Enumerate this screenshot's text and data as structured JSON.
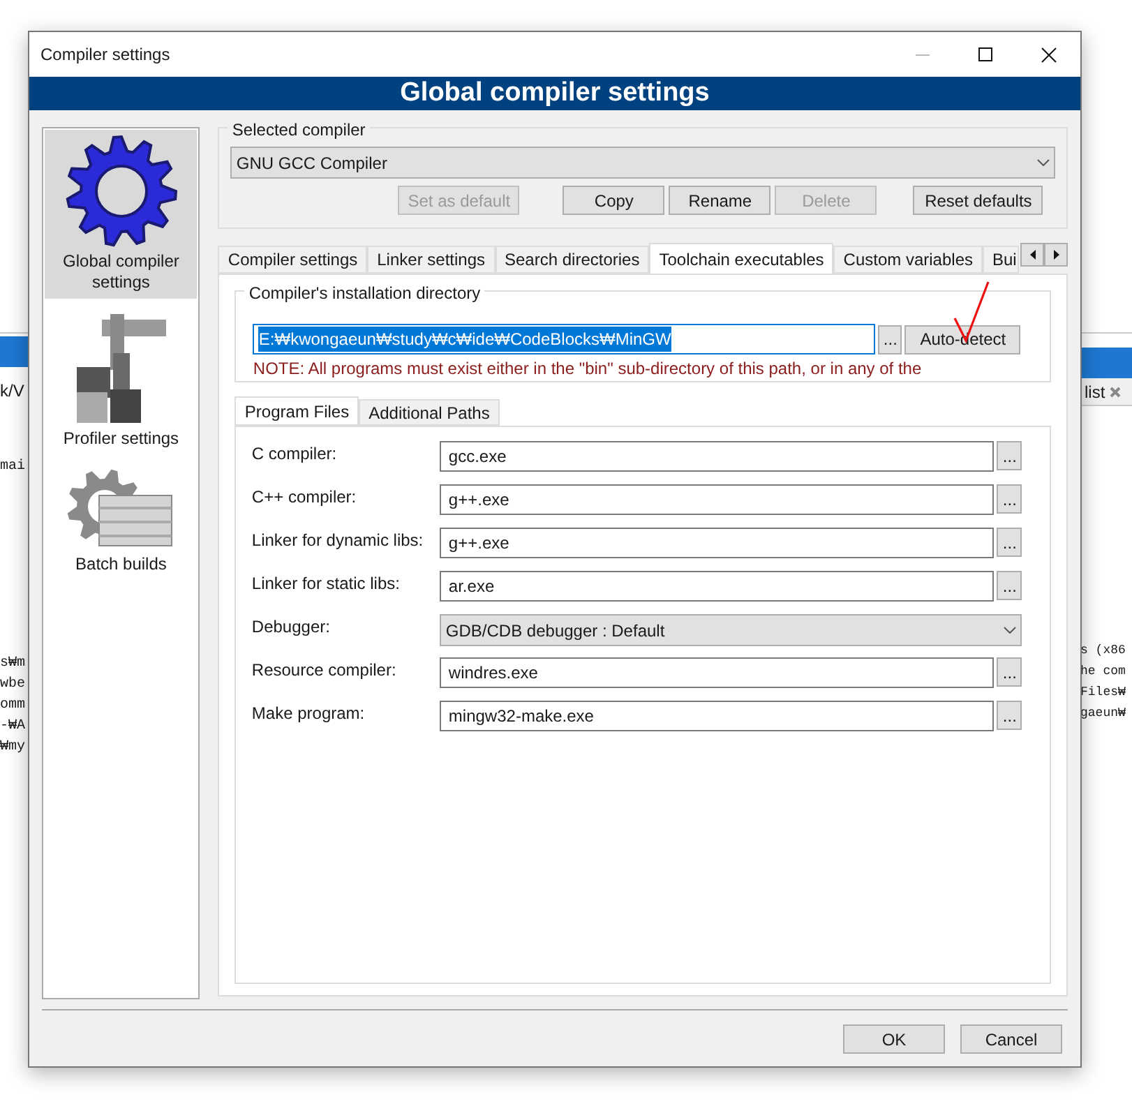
{
  "left_window": {
    "tab_text": "k/V",
    "code_blocks": [
      [
        "mai"
      ],
      [
        "s₩m",
        "wbe",
        "omm",
        "-₩A",
        "₩my"
      ]
    ]
  },
  "right_window": {
    "tab_text": "list",
    "code_lines": [
      "s (x86",
      "he com",
      "Files₩",
      "gaeun₩"
    ]
  },
  "window": {
    "title": "Compiler settings"
  },
  "header": "Global compiler settings",
  "sidebar": {
    "items": [
      {
        "label": "Global compiler settings",
        "selected": true,
        "kind": "gear"
      },
      {
        "label": "Profiler settings",
        "selected": false,
        "kind": "caliper"
      },
      {
        "label": "Batch builds",
        "selected": false,
        "kind": "batch"
      }
    ]
  },
  "selected_compiler": {
    "legend": "Selected compiler",
    "value": "GNU GCC Compiler",
    "buttons": [
      {
        "label": "Set as default",
        "disabled": true
      },
      {
        "label": "Copy",
        "disabled": false
      },
      {
        "label": "Rename",
        "disabled": false
      },
      {
        "label": "Delete",
        "disabled": true
      },
      {
        "label": "Reset defaults",
        "disabled": false
      }
    ]
  },
  "tabs": [
    {
      "label": "Compiler settings",
      "selected": false
    },
    {
      "label": "Linker settings",
      "selected": false
    },
    {
      "label": "Search directories",
      "selected": false
    },
    {
      "label": "Toolchain executables",
      "selected": true
    },
    {
      "label": "Custom variables",
      "selected": false
    },
    {
      "label": "Bui",
      "selected": false
    }
  ],
  "install_dir": {
    "legend": "Compiler's installation directory",
    "value": "E:₩kwongaeun₩study₩c₩ide₩CodeBlocks₩MinGW",
    "browse": "...",
    "auto_detect": "Auto-detect",
    "note": "NOTE: All programs must exist either in the \"bin\" sub-directory of this path, or in any of the"
  },
  "sub_tabs": [
    {
      "label": "Program Files",
      "selected": true
    },
    {
      "label": "Additional Paths",
      "selected": false
    }
  ],
  "fields": [
    {
      "label": "C compiler:",
      "value": "gcc.exe",
      "kind": "text",
      "browse": "..."
    },
    {
      "label": "C++ compiler:",
      "value": "g++.exe",
      "kind": "text",
      "browse": "..."
    },
    {
      "label": "Linker for dynamic libs:",
      "value": "g++.exe",
      "kind": "text",
      "browse": "..."
    },
    {
      "label": "Linker for static libs:",
      "value": "ar.exe",
      "kind": "text",
      "browse": "..."
    },
    {
      "label": "Debugger:",
      "value": "GDB/CDB debugger : Default",
      "kind": "select"
    },
    {
      "label": "Resource compiler:",
      "value": "windres.exe",
      "kind": "text",
      "browse": "..."
    },
    {
      "label": "Make program:",
      "value": "mingw32-make.exe",
      "kind": "text",
      "browse": "..."
    }
  ],
  "footer_buttons": [
    "OK",
    "Cancel"
  ]
}
